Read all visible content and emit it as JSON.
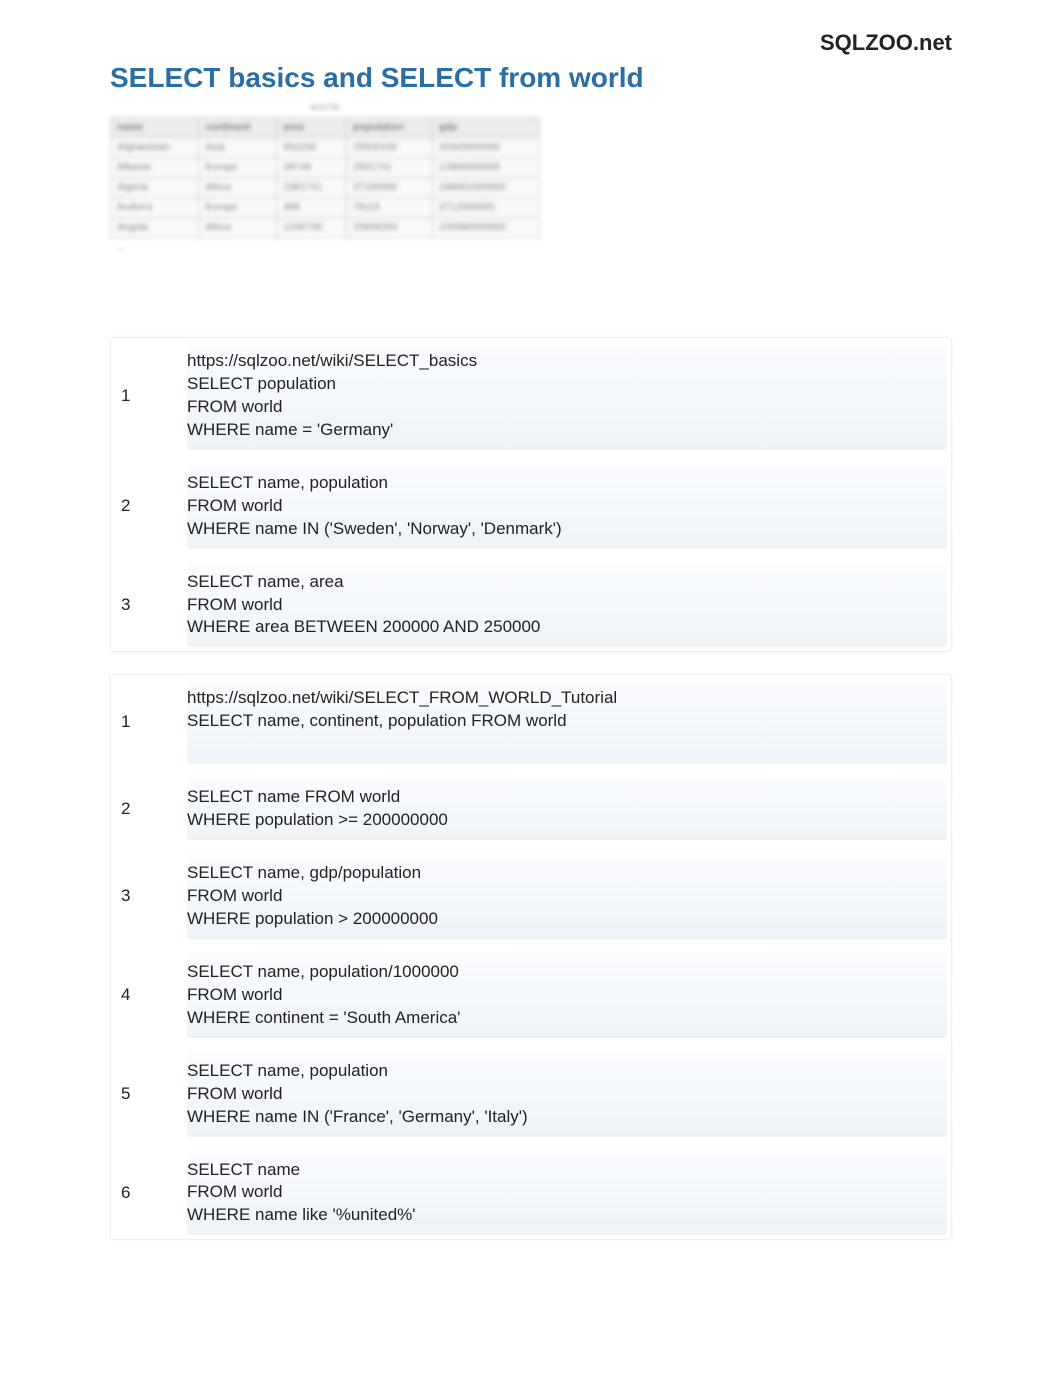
{
  "site_name": "SQLZOO.net",
  "page_title": "SELECT basics and SELECT from world",
  "thumb": {
    "caption": "world",
    "headers": [
      "name",
      "continent",
      "area",
      "population",
      "gdp"
    ],
    "rows": [
      [
        "Afghanistan",
        "Asia",
        "652230",
        "25500100",
        "20343000000"
      ],
      [
        "Albania",
        "Europe",
        "28748",
        "2831741",
        "12960000000"
      ],
      [
        "Algeria",
        "Africa",
        "2381741",
        "37100000",
        "188681000000"
      ],
      [
        "Andorra",
        "Europe",
        "468",
        "78115",
        "3712000000"
      ],
      [
        "Angola",
        "Africa",
        "1246700",
        "20609294",
        "100990000000"
      ]
    ],
    "ellipsis": "..."
  },
  "sections": [
    {
      "url": "https://sqlzoo.net/wiki/SELECT_basics",
      "items": [
        {
          "n": "1",
          "code": "SELECT population\nFROM world\nWHERE name = 'Germany'"
        },
        {
          "n": "2",
          "code": "SELECT name, population\nFROM world\nWHERE name IN ('Sweden', 'Norway', 'Denmark')"
        },
        {
          "n": "3",
          "code": "SELECT name, area\nFROM world\nWHERE area BETWEEN 200000 AND 250000"
        }
      ]
    },
    {
      "url": "https://sqlzoo.net/wiki/SELECT_FROM_WORLD_Tutorial",
      "items": [
        {
          "n": "1",
          "code": "SELECT name, continent, population FROM world\n\n"
        },
        {
          "n": "2",
          "code": "SELECT name FROM world\nWHERE population >= 200000000\n"
        },
        {
          "n": "3",
          "code": "SELECT name, gdp/population\nFROM world\nWHERE population > 200000000"
        },
        {
          "n": "4",
          "code": "SELECT name, population/1000000\nFROM world\nWHERE continent = 'South America'"
        },
        {
          "n": "5",
          "code": "SELECT name, population\nFROM world\nWHERE name IN ('France', 'Germany', 'Italy')"
        },
        {
          "n": "6",
          "code": "SELECT name\nFROM world\nWHERE name like '%united%'"
        }
      ]
    }
  ]
}
